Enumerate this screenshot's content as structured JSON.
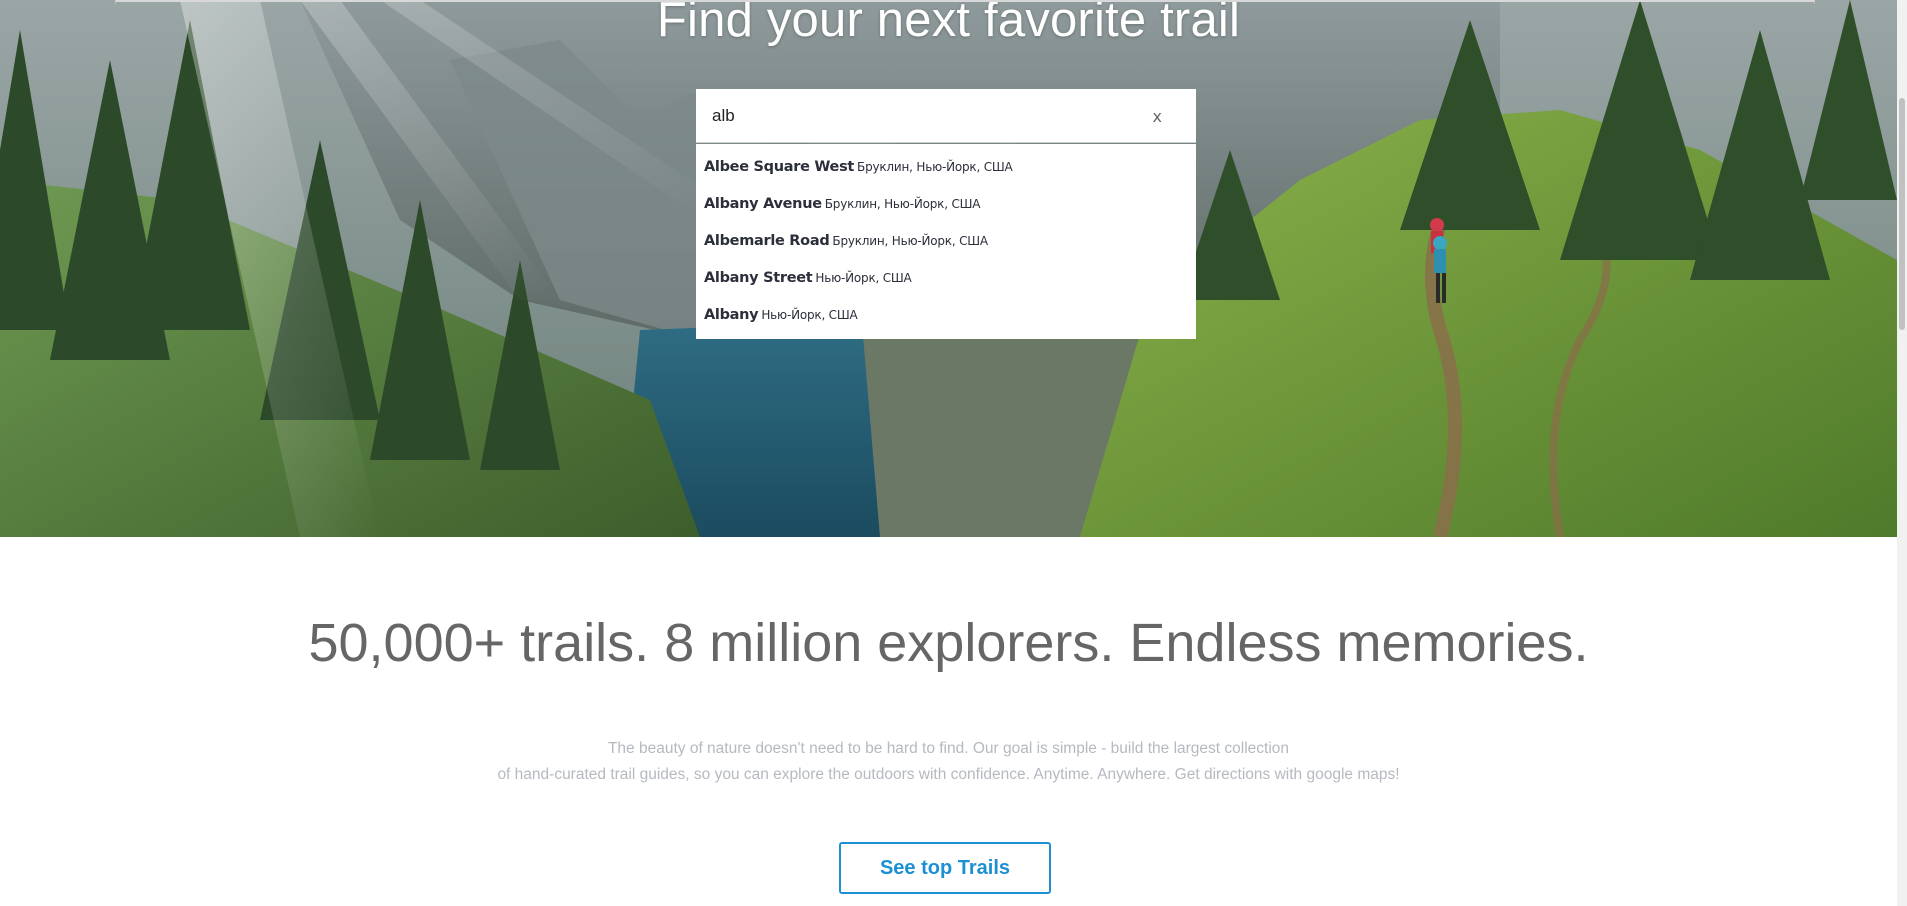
{
  "hero": {
    "title": "Find your next favorite trail"
  },
  "search": {
    "value": "alb",
    "clear_label": "x",
    "suggestions": [
      {
        "main": "Albee Square West",
        "secondary": "Бруклин, Нью-Йорк, США"
      },
      {
        "main": "Albany Avenue",
        "secondary": "Бруклин, Нью-Йорк, США"
      },
      {
        "main": "Albemarle Road",
        "secondary": "Бруклин, Нью-Йорк, США"
      },
      {
        "main": "Albany Street",
        "secondary": "Нью-Йорк, США"
      },
      {
        "main": "Albany",
        "secondary": "Нью-Йорк, США"
      }
    ]
  },
  "content": {
    "tagline": "50,000+ trails. 8 million explorers. Endless memories.",
    "description_line1": "The beauty of nature doesn't need to be hard to find. Our goal is simple - build the largest collection",
    "description_line2": "of hand-curated trail guides, so you can explore the outdoors with confidence. Anytime. Anywhere. Get directions with google maps!",
    "cta_label": "See top Trails"
  },
  "colors": {
    "accent": "#1d8fd3",
    "tagline": "#666666",
    "description": "#b5b9c0"
  },
  "icons": {
    "clear": "close-icon"
  }
}
